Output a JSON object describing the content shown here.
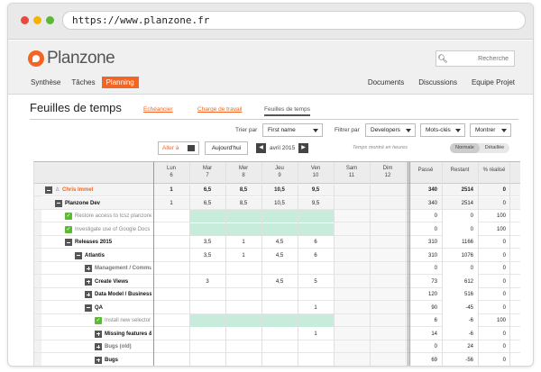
{
  "browser": {
    "url": "https://www.planzone.fr"
  },
  "app": {
    "logo_text": "Planzone",
    "search_placeholder": "Recherche",
    "menu_left": [
      "Synthèse",
      "Tâches",
      "Planning"
    ],
    "menu_active": "Planning",
    "menu_right": [
      "Documents",
      "Discussions",
      "Equipe Projet"
    ]
  },
  "page": {
    "title": "Feuilles de temps",
    "subtabs": [
      "Echéancier",
      "Charge de travail",
      "Feuilles de temps"
    ],
    "subtab_active": "Feuilles de temps"
  },
  "controls": {
    "sort_label": "Trier par",
    "sort_value": "First name",
    "filter_label": "Filtrer par",
    "filter_value": "Developers",
    "keywords_value": "Mots-clés",
    "show_value": "Montrer",
    "goto_label": "Aller à",
    "today_label": "Aujourd'hui",
    "month_label": "avril 2015",
    "time_note": "Temps montré en heures",
    "view_normal": "Normale",
    "view_detail": "Détaillée",
    "view_active": "Normale"
  },
  "grid": {
    "days": [
      {
        "name": "Lun",
        "num": "6"
      },
      {
        "name": "Mar",
        "num": "7"
      },
      {
        "name": "Mer",
        "num": "8"
      },
      {
        "name": "Jeu",
        "num": "9"
      },
      {
        "name": "Ven",
        "num": "10"
      },
      {
        "name": "Sam",
        "num": "11"
      },
      {
        "name": "Dim",
        "num": "12"
      }
    ],
    "totals_headers": [
      "Passé",
      "Restant",
      "% réalisé"
    ],
    "rows": [
      {
        "label": "Chris Immel",
        "indent": 0,
        "kind": "user",
        "icon": "minus",
        "values": [
          "1",
          "6,5",
          "8,5",
          "10,5",
          "9,5",
          "",
          ""
        ],
        "passe": "340",
        "restant": "2514",
        "pct": "0",
        "green": false
      },
      {
        "label": "Planzone Dev",
        "indent": 1,
        "kind": "bold",
        "icon": "minus",
        "values": [
          "1",
          "6,5",
          "8,5",
          "10,5",
          "9,5",
          "",
          ""
        ],
        "passe": "340",
        "restant": "2514",
        "pct": "0",
        "green": false
      },
      {
        "label": "Restore access to tcsz planzone",
        "indent": 2,
        "kind": "task",
        "icon": "check",
        "values": [
          "",
          "",
          "",
          "",
          "",
          "",
          ""
        ],
        "passe": "0",
        "restant": "0",
        "pct": "100",
        "green": true
      },
      {
        "label": "Investigate use of Google Docs",
        "indent": 2,
        "kind": "task",
        "icon": "check",
        "values": [
          "",
          "",
          "",
          "",
          "",
          "",
          ""
        ],
        "passe": "0",
        "restant": "0",
        "pct": "100",
        "green": true
      },
      {
        "label": "Releases 2015",
        "indent": 2,
        "kind": "bold",
        "icon": "minus",
        "values": [
          "",
          "3,5",
          "1",
          "4,5",
          "6",
          "",
          ""
        ],
        "passe": "310",
        "restant": "1166",
        "pct": "0",
        "green": false
      },
      {
        "label": "Atlantis",
        "indent": 3,
        "kind": "bold",
        "icon": "minus",
        "values": [
          "",
          "3,5",
          "1",
          "4,5",
          "6",
          "",
          ""
        ],
        "passe": "310",
        "restant": "1076",
        "pct": "0",
        "green": false
      },
      {
        "label": "Management / Commu",
        "indent": 4,
        "kind": "bold-grey",
        "icon": "plus",
        "values": [
          "",
          "",
          "",
          "",
          "",
          "",
          ""
        ],
        "passe": "0",
        "restant": "0",
        "pct": "0",
        "green": false
      },
      {
        "label": "Create Views",
        "indent": 4,
        "kind": "bold",
        "icon": "plus",
        "values": [
          "",
          "3",
          "",
          "4,5",
          "5",
          "",
          ""
        ],
        "passe": "73",
        "restant": "612",
        "pct": "0",
        "green": false
      },
      {
        "label": "Data Model / Business",
        "indent": 4,
        "kind": "bold",
        "icon": "plus",
        "values": [
          "",
          "",
          "",
          "",
          "",
          "",
          ""
        ],
        "passe": "120",
        "restant": "516",
        "pct": "0",
        "green": false
      },
      {
        "label": "QA",
        "indent": 4,
        "kind": "bold",
        "icon": "minus",
        "values": [
          "",
          "",
          "",
          "",
          "1",
          "",
          ""
        ],
        "passe": "90",
        "restant": "-45",
        "pct": "0",
        "green": false
      },
      {
        "label": "Install new selector",
        "indent": 5,
        "kind": "task",
        "icon": "check",
        "values": [
          "",
          "",
          "",
          "",
          "",
          "",
          ""
        ],
        "passe": "6",
        "restant": "-6",
        "pct": "100",
        "green": true
      },
      {
        "label": "Missing features &",
        "indent": 5,
        "kind": "bold",
        "icon": "plus",
        "values": [
          "",
          "",
          "",
          "",
          "1",
          "",
          ""
        ],
        "passe": "14",
        "restant": "-6",
        "pct": "0",
        "green": false
      },
      {
        "label": "Bugs (old)",
        "indent": 5,
        "kind": "bold-grey",
        "icon": "plus",
        "values": [
          "",
          "",
          "",
          "",
          "",
          "",
          ""
        ],
        "passe": "0",
        "restant": "24",
        "pct": "0",
        "green": false
      },
      {
        "label": "Bugs",
        "indent": 5,
        "kind": "bold",
        "icon": "plus",
        "values": [
          "",
          "",
          "",
          "",
          "",
          "",
          ""
        ],
        "passe": "69",
        "restant": "-56",
        "pct": "0",
        "green": false
      }
    ]
  }
}
